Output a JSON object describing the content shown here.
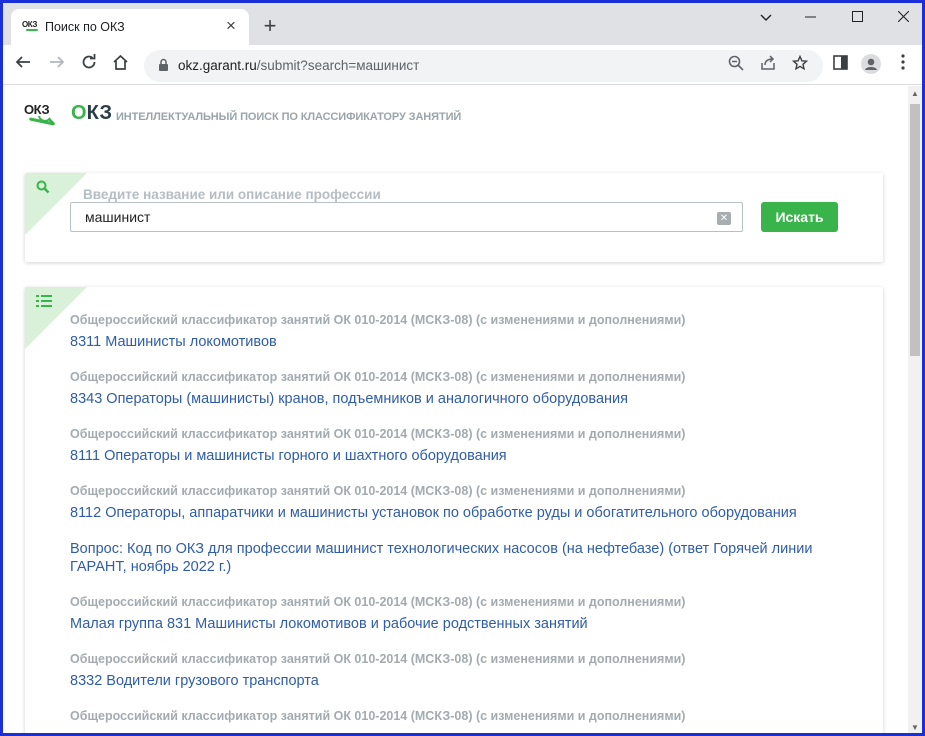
{
  "browser": {
    "tab_title": "Поиск по ОКЗ",
    "tab_close": "×",
    "new_tab": "+",
    "favicon_text": "ОКЗ",
    "url_host": "okz.garant.ru",
    "url_path": "/submit?search=машинист",
    "window_controls": {
      "minimize": "—",
      "maximize": "☐",
      "close": "✕",
      "tabs_menu": "⌄"
    }
  },
  "header": {
    "logo_text": "ОКЗ",
    "brand_first": "О",
    "brand_rest": "КЗ",
    "tagline": "ИНТЕЛЛЕКТУАЛЬНЫЙ ПОИСК ПО КЛАССИФИКАТОРУ ЗАНЯТИЙ"
  },
  "search": {
    "label": "Введите название или описание профессии",
    "value": "машинист",
    "clear": "✕",
    "button": "Искать"
  },
  "results": [
    {
      "source": "Общероссийский классификатор занятий ОК 010-2014 (МСКЗ-08) (с изменениями и дополнениями)",
      "title": "8311 Машинисты локомотивов"
    },
    {
      "source": "Общероссийский классификатор занятий ОК 010-2014 (МСКЗ-08) (с изменениями и дополнениями)",
      "title": "8343 Операторы (машинисты) кранов, подъемников и аналогичного оборудования"
    },
    {
      "source": "Общероссийский классификатор занятий ОК 010-2014 (МСКЗ-08) (с изменениями и дополнениями)",
      "title": "8111 Операторы и машинисты горного и шахтного оборудования"
    },
    {
      "source": "Общероссийский классификатор занятий ОК 010-2014 (МСКЗ-08) (с изменениями и дополнениями)",
      "title": "8112 Операторы, аппаратчики и машинисты установок по обработке руды и обогатительного оборудования"
    },
    {
      "source": "",
      "title": "Вопрос: Код по ОКЗ для профессии машинист технологических насосов (на нефтебазе) (ответ Горячей линии ГАРАНТ, ноябрь 2022 г.)"
    },
    {
      "source": "Общероссийский классификатор занятий ОК 010-2014 (МСКЗ-08) (с изменениями и дополнениями)",
      "title": "Малая группа 831 Машинисты локомотивов и рабочие родственных занятий"
    },
    {
      "source": "Общероссийский классификатор занятий ОК 010-2014 (МСКЗ-08) (с изменениями и дополнениями)",
      "title": "8332 Водители грузового транспорта"
    },
    {
      "source": "Общероссийский классификатор занятий ОК 010-2014 (МСКЗ-08) (с изменениями и дополнениями)",
      "title": ""
    }
  ],
  "colors": {
    "accent": "#38b44a",
    "link": "#2f5da8",
    "corner": "#d9f0d9",
    "window_border": "#1a2fd8"
  }
}
